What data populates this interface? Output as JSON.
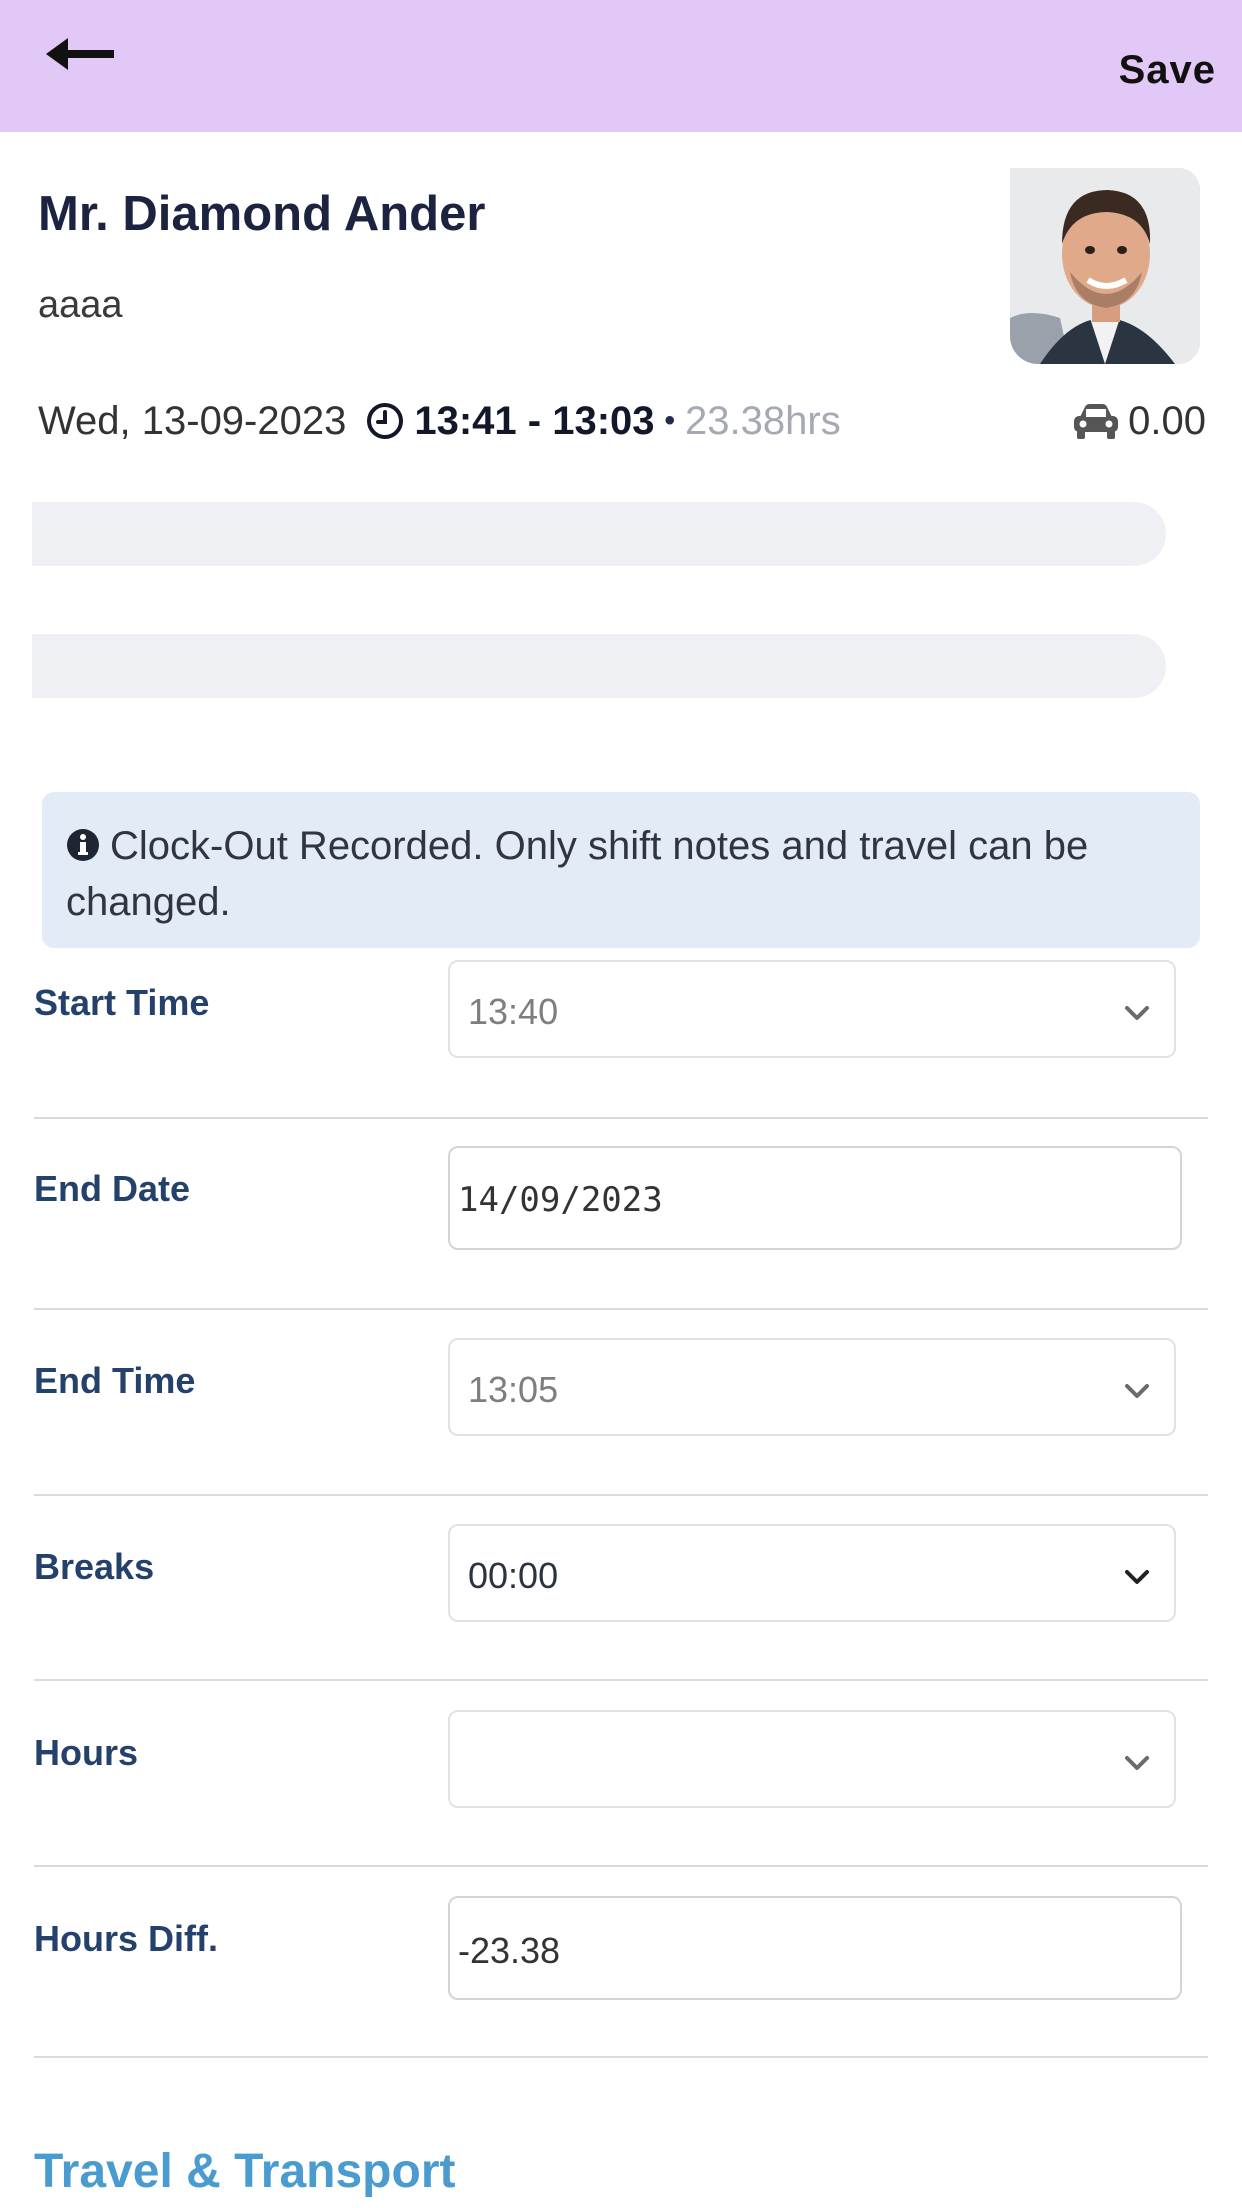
{
  "header": {
    "back_icon": "arrow-left-icon",
    "save_label": "Save",
    "background_color": "#e1c8f7"
  },
  "profile": {
    "name": "Mr. Diamond Ander",
    "subtitle": "aaaa",
    "avatar_icon": "person-photo"
  },
  "shift": {
    "date": "Wed, 13-09-2023",
    "time_range": "13:41 - 13:03",
    "duration": "23.38hrs",
    "travel_value": "0.00",
    "clock_icon": "clock-icon",
    "car_icon": "car-icon"
  },
  "alert": {
    "icon": "info-circle-icon",
    "text": "Clock-Out Recorded. Only shift notes and travel can be changed.",
    "background_color": "#e3ebf7"
  },
  "form": {
    "start_time": {
      "label": "Start Time",
      "value": "13:40"
    },
    "end_date": {
      "label": "End Date",
      "value": "14/09/2023"
    },
    "end_time": {
      "label": "End Time",
      "value": "13:05"
    },
    "breaks": {
      "label": "Breaks",
      "value": "00:00"
    },
    "hours": {
      "label": "Hours",
      "value": ""
    },
    "hours_diff": {
      "label": "Hours Diff.",
      "value": "-23.38"
    }
  },
  "section": {
    "travel_title": "Travel & Transport",
    "title_color": "#4a9bcf"
  }
}
